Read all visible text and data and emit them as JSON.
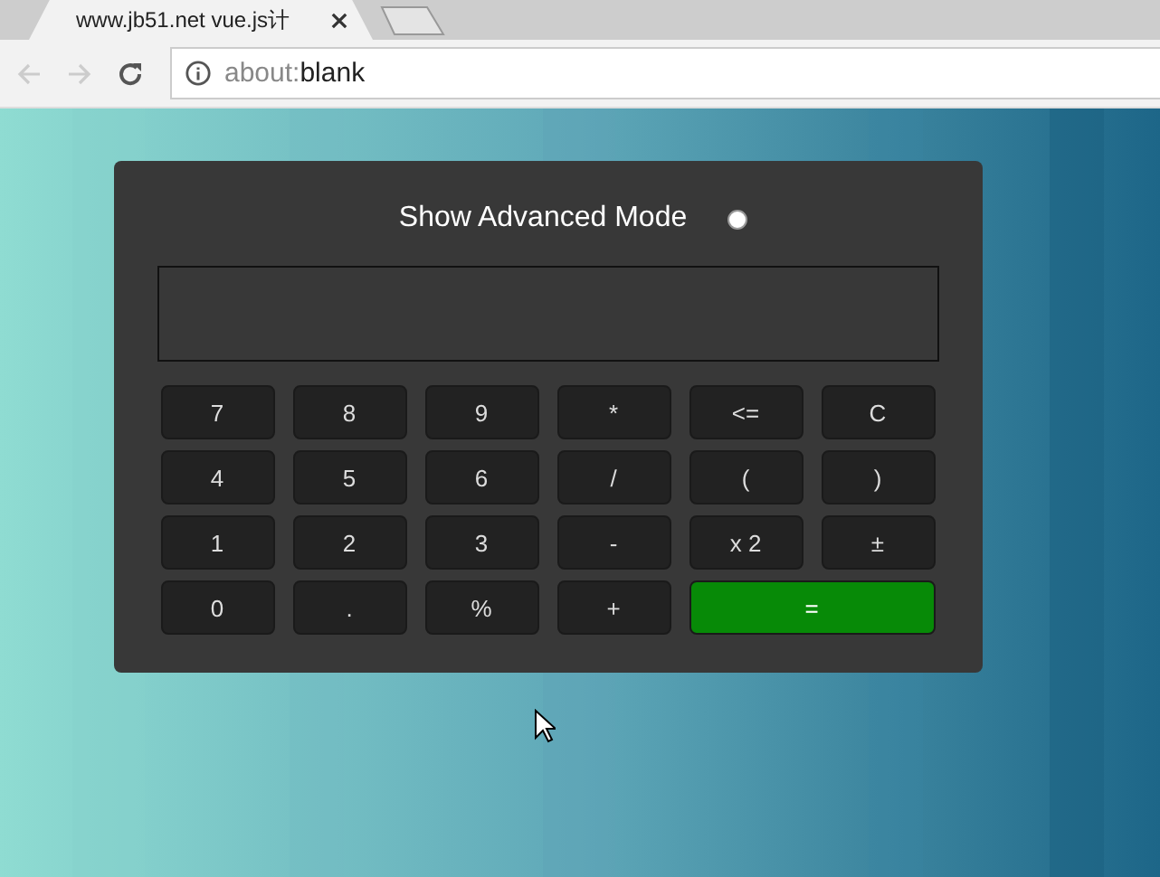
{
  "browser": {
    "tab": {
      "title": "www.jb51.net vue.js计",
      "selected": true
    },
    "address": {
      "scheme": "about:",
      "path": "blank"
    }
  },
  "calculator": {
    "toggle": {
      "label": "Show Advanced Mode",
      "checked": false
    },
    "keys": [
      {
        "label": "7",
        "kind": "key"
      },
      {
        "label": "8",
        "kind": "key"
      },
      {
        "label": "9",
        "kind": "key"
      },
      {
        "label": "*",
        "kind": "key"
      },
      {
        "label": "<=",
        "kind": "key"
      },
      {
        "label": "C",
        "kind": "key"
      },
      {
        "label": "4",
        "kind": "key"
      },
      {
        "label": "5",
        "kind": "key"
      },
      {
        "label": "6",
        "kind": "key"
      },
      {
        "label": "/",
        "kind": "key"
      },
      {
        "label": "(",
        "kind": "key"
      },
      {
        "label": ")",
        "kind": "key"
      },
      {
        "label": "1",
        "kind": "key"
      },
      {
        "label": "2",
        "kind": "key"
      },
      {
        "label": "3",
        "kind": "key"
      },
      {
        "label": "-",
        "kind": "key"
      },
      {
        "label": "x 2",
        "kind": "key"
      },
      {
        "label": "±",
        "kind": "key"
      },
      {
        "label": "0",
        "kind": "key"
      },
      {
        "label": ".",
        "kind": "key"
      },
      {
        "label": "%",
        "kind": "key"
      },
      {
        "label": "+",
        "kind": "key"
      },
      {
        "label": "=",
        "kind": "equals"
      }
    ]
  }
}
